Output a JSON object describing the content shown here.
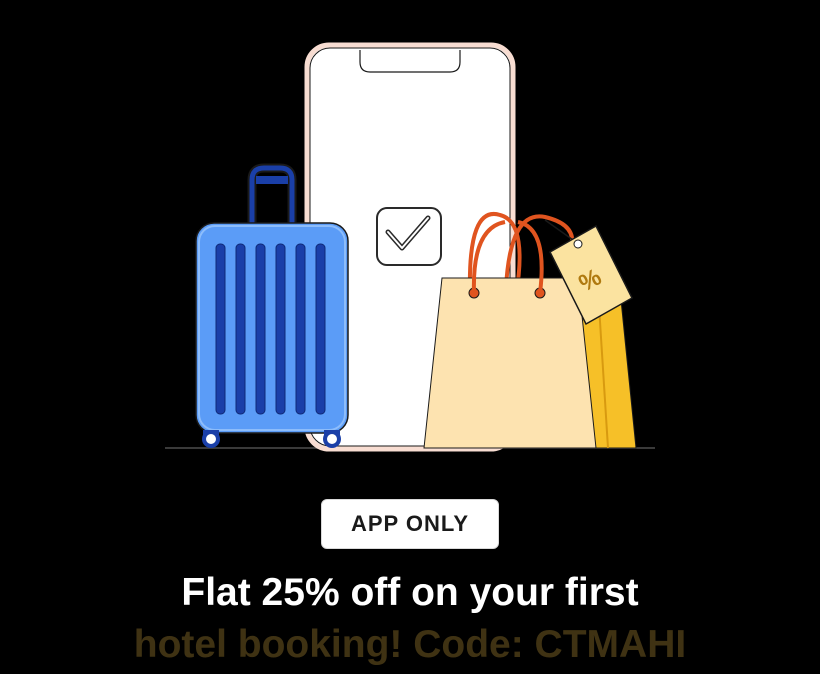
{
  "badge": {
    "label": "APP ONLY"
  },
  "offer": {
    "line1": "Flat 25% off on your first",
    "line2": "hotel booking! Code: CTMAHI"
  },
  "illustration": {
    "tag_symbol": "%",
    "icons": [
      "phone-icon",
      "checkmark-icon",
      "suitcase-icon",
      "shopping-bag-icon",
      "price-tag-icon"
    ]
  },
  "colors": {
    "background": "#000000",
    "suitcase": "#5b9cf7",
    "suitcase_stripes": "#1a3fa8",
    "bag": "#fde3b0",
    "bag_side": "#f6c028",
    "handles": "#e0541f",
    "tag": "#fbe3a0",
    "phone_border": "#f8ddd2",
    "offer_line1": "#ffffff",
    "offer_line2": "#3f3213"
  }
}
